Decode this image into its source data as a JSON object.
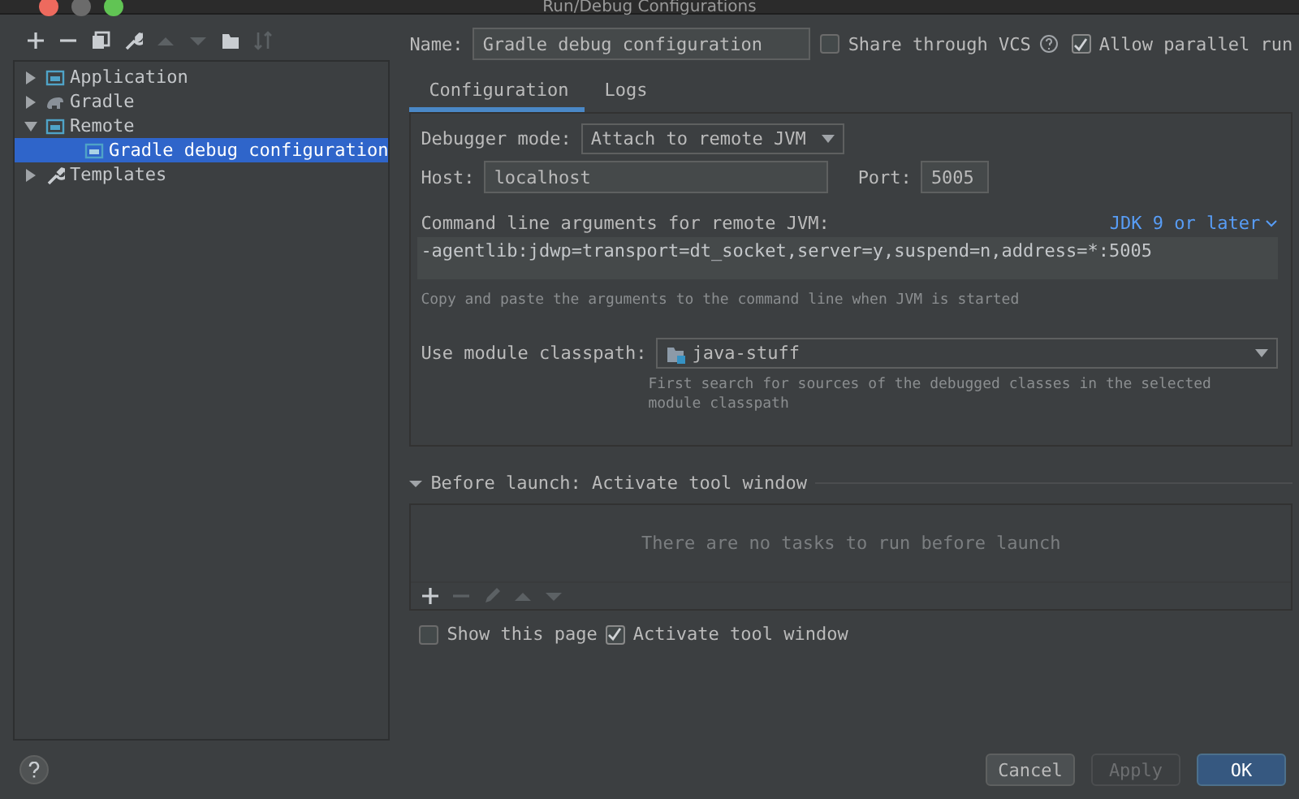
{
  "window": {
    "title": "Run/Debug Configurations"
  },
  "toolbar": [
    {
      "kind": "add",
      "disabled": false
    },
    {
      "kind": "remove",
      "disabled": false
    },
    {
      "kind": "copy",
      "disabled": false
    },
    {
      "kind": "wrench",
      "disabled": false
    },
    {
      "kind": "up",
      "disabled": true
    },
    {
      "kind": "down",
      "disabled": true
    },
    {
      "kind": "folder",
      "disabled": false
    },
    {
      "kind": "sort",
      "disabled": true
    }
  ],
  "tree": [
    {
      "label": "Application",
      "kind": "application",
      "expanded": false,
      "selected": false
    },
    {
      "label": "Gradle",
      "kind": "gradle",
      "expanded": false,
      "selected": false
    },
    {
      "label": "Remote",
      "kind": "remote",
      "expanded": true,
      "selected": false,
      "children": [
        {
          "label": "Gradle debug configuration",
          "kind": "config",
          "selected": true
        }
      ]
    },
    {
      "label": "Templates",
      "kind": "wrench",
      "expanded": false,
      "selected": false
    }
  ],
  "name": {
    "label": "Name:",
    "value": "Gradle debug configuration"
  },
  "options": [
    {
      "label": "Share through VCS",
      "checked": false,
      "help": true
    },
    {
      "label": "Allow parallel run",
      "checked": true,
      "help": false
    }
  ],
  "tabs": [
    {
      "label": "Configuration",
      "selected": true
    },
    {
      "label": "Logs",
      "selected": false
    }
  ],
  "debugger_mode": {
    "label": "Debugger mode:",
    "value": "Attach to remote JVM"
  },
  "host": {
    "label": "Host:",
    "value": "localhost"
  },
  "port": {
    "label": "Port:",
    "value": "5005"
  },
  "command_line": {
    "label": "Command line arguments for remote JVM:",
    "jdk_link": "JDK 9 or later",
    "value": "-agentlib:jdwp=transport=dt_socket,server=y,suspend=n,address=*:5005",
    "hint": "Copy and paste the arguments to the command line when JVM is started"
  },
  "module_classpath": {
    "label": "Use module classpath:",
    "value": "java-stuff",
    "hint": "First search for sources of the debugged classes in the selected module classpath"
  },
  "before_launch": {
    "title": "Before launch: Activate tool window",
    "expanded": true,
    "empty_text": "There are no tasks to run before launch",
    "toolbar": [
      {
        "kind": "add",
        "disabled": false
      },
      {
        "kind": "remove",
        "disabled": true
      },
      {
        "kind": "edit",
        "disabled": true
      },
      {
        "kind": "up",
        "disabled": true
      },
      {
        "kind": "down",
        "disabled": true
      }
    ]
  },
  "launch_options": [
    {
      "label": "Show this page",
      "checked": false
    },
    {
      "label": "Activate tool window",
      "checked": true
    }
  ],
  "buttons": [
    {
      "label": "Cancel",
      "kind": "secondary"
    },
    {
      "label": "Apply",
      "kind": "disabled"
    },
    {
      "label": "OK",
      "kind": "primary"
    }
  ]
}
